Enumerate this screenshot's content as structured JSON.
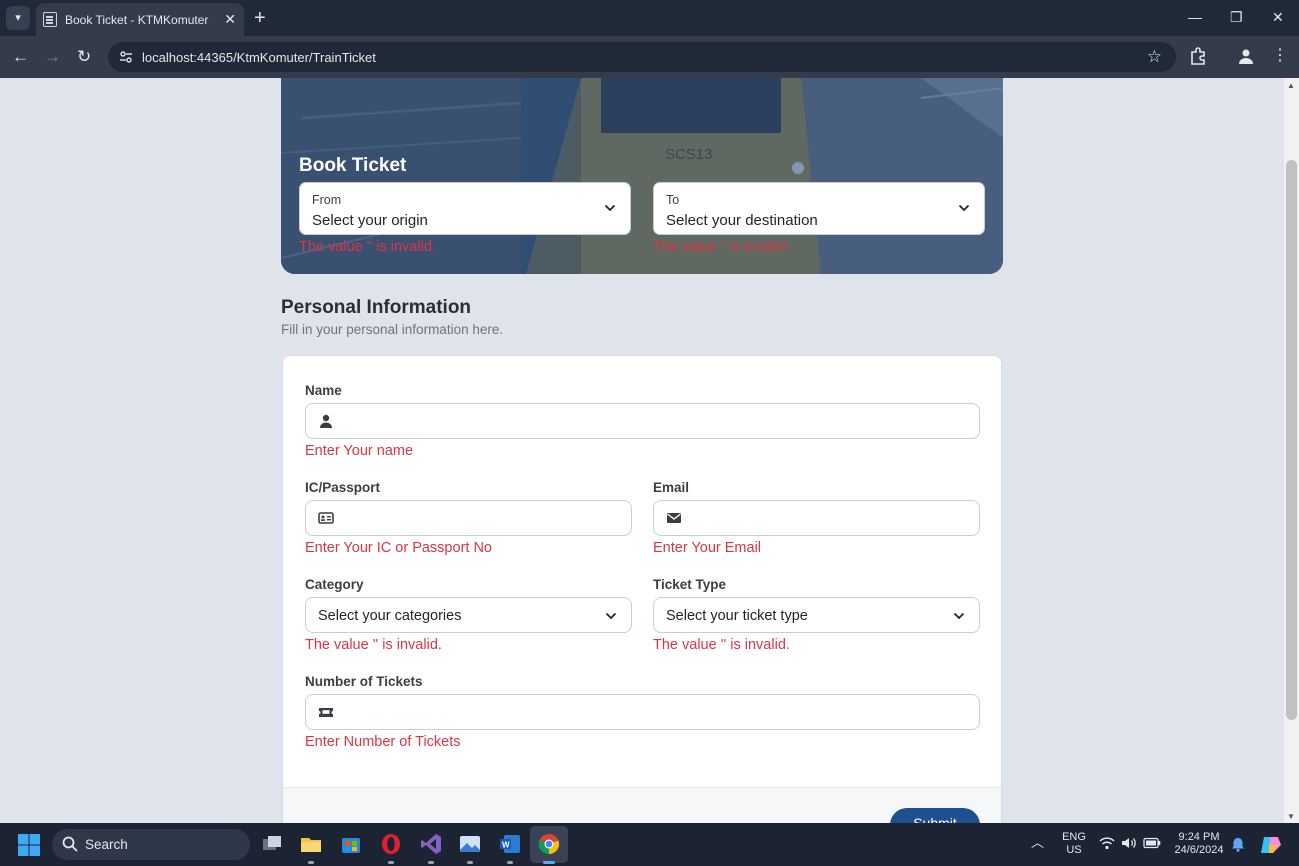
{
  "browser": {
    "tab_title": "Book Ticket - KTMKomuter",
    "url": "localhost:44365/KtmKomuter/TrainTicket"
  },
  "hero": {
    "title": "Book Ticket",
    "train_code": "SCS13",
    "from": {
      "label": "From",
      "value": "Select your origin",
      "error": "The value '' is invalid."
    },
    "to": {
      "label": "To",
      "value": "Select your destination",
      "error": "The value '' is invalid."
    }
  },
  "personal": {
    "title": "Personal Information",
    "subtitle": "Fill in your personal information here.",
    "name": {
      "label": "Name",
      "value": "",
      "error": "Enter Your name",
      "icon": "user-icon"
    },
    "ic": {
      "label": "IC/Passport",
      "value": "",
      "error": "Enter Your IC or Passport No",
      "icon": "id-card-icon"
    },
    "email": {
      "label": "Email",
      "value": "",
      "error": "Enter Your Email",
      "icon": "envelope-icon"
    },
    "category": {
      "label": "Category",
      "value": "Select your categories",
      "error": "The value '' is invalid."
    },
    "ticket_type": {
      "label": "Ticket Type",
      "value": "Select your ticket type",
      "error": "The value '' is invalid."
    },
    "tickets": {
      "label": "Number of Tickets",
      "value": "",
      "error": "Enter Number of Tickets",
      "icon": "ticket-icon"
    },
    "submit_label": "Submit"
  },
  "taskbar": {
    "search_label": "Search",
    "lang_top": "ENG",
    "lang_bottom": "US",
    "time": "9:24 PM",
    "date": "24/6/2024"
  },
  "colors": {
    "error": "#dc3545",
    "primary": "#1d4f91",
    "page_bg": "#dfe3ec"
  }
}
